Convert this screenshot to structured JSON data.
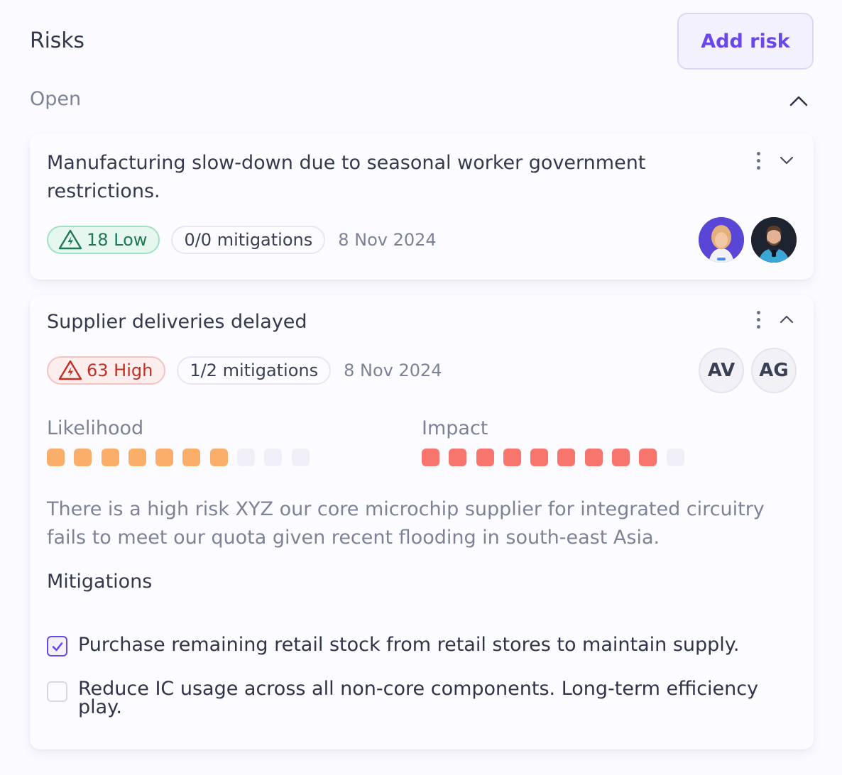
{
  "header": {
    "title": "Risks",
    "add_button_label": "Add risk"
  },
  "section": {
    "title": "Open",
    "expanded": true
  },
  "risks": [
    {
      "title": "Manufacturing slow-down due to seasonal worker government restrictions.",
      "score_label": "18 Low",
      "severity": "low",
      "mitigations_label": "0/0 mitigations",
      "date": "8 Nov 2024",
      "expanded": false,
      "assignees": [
        {
          "type": "photo",
          "icon": "avatar-photo-woman"
        },
        {
          "type": "photo",
          "icon": "avatar-photo-man"
        }
      ]
    },
    {
      "title": "Supplier deliveries delayed",
      "score_label": "63 High",
      "severity": "high",
      "mitigations_label": "1/2 mitigations",
      "date": "8 Nov 2024",
      "expanded": true,
      "assignees": [
        {
          "type": "initials",
          "initials": "AV"
        },
        {
          "type": "initials",
          "initials": "AG"
        }
      ],
      "likelihood": {
        "label": "Likelihood",
        "value": 7,
        "max": 10
      },
      "impact": {
        "label": "Impact",
        "value": 9,
        "max": 10
      },
      "description": "There is a high risk XYZ our core microchip supplier for integrated circuitry fails to meet our quota given recent flooding in south-east Asia.",
      "mitigations_title": "Mitigations",
      "mitigations": [
        {
          "text": "Purchase remaining retail stock from retail stores to maintain supply.",
          "checked": true
        },
        {
          "text": "Reduce IC usage across all non-core components. Long-term efficiency play.",
          "checked": false
        }
      ]
    }
  ],
  "colors": {
    "accent": "#6a47ea",
    "low": "#1d7a52",
    "high": "#c52d23",
    "likelihood_dot": "#fbae6a",
    "impact_dot": "#f8756d",
    "empty_dot": "#f0eff7"
  }
}
